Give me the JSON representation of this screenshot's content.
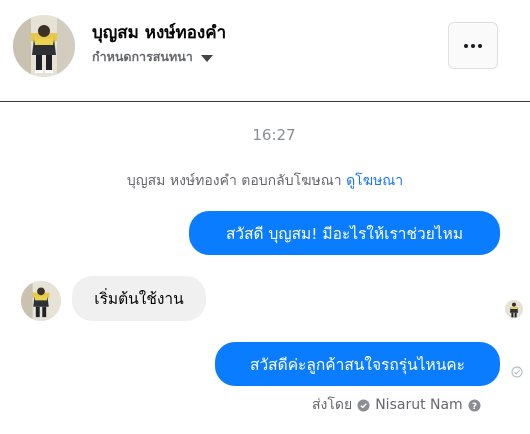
{
  "header": {
    "contact_name": "บุญสม หงษ์ทองคำ",
    "subtitle": "กำหนดการสนทนา",
    "avatar_icon": "person-photo-icon",
    "more_icon": "more-options-icon"
  },
  "conversation": {
    "timestamp": "16:27",
    "notice": {
      "text": "บุญสม หงษ์ทองคำ ตอบกลับโฆษณา",
      "link": "ดูโฆษณา"
    },
    "messages": [
      {
        "direction": "outgoing",
        "text": "สวัสดี บุญสม! มีอะไรให้เราช่วยไหม"
      },
      {
        "direction": "incoming",
        "text": "เริ่มต้นใช้งาน"
      },
      {
        "direction": "outgoing",
        "text": "สวัสดีค่ะลูกค้าสนใจรถรุ่นไหนคะ"
      }
    ],
    "sent_by": {
      "label": "ส่งโดย",
      "name": "Nisarut Nam"
    }
  },
  "colors": {
    "outgoing_bubble": "#0a7cff",
    "incoming_bubble": "#f0f0f0",
    "link": "#1877f2",
    "muted_text": "#65676b"
  }
}
